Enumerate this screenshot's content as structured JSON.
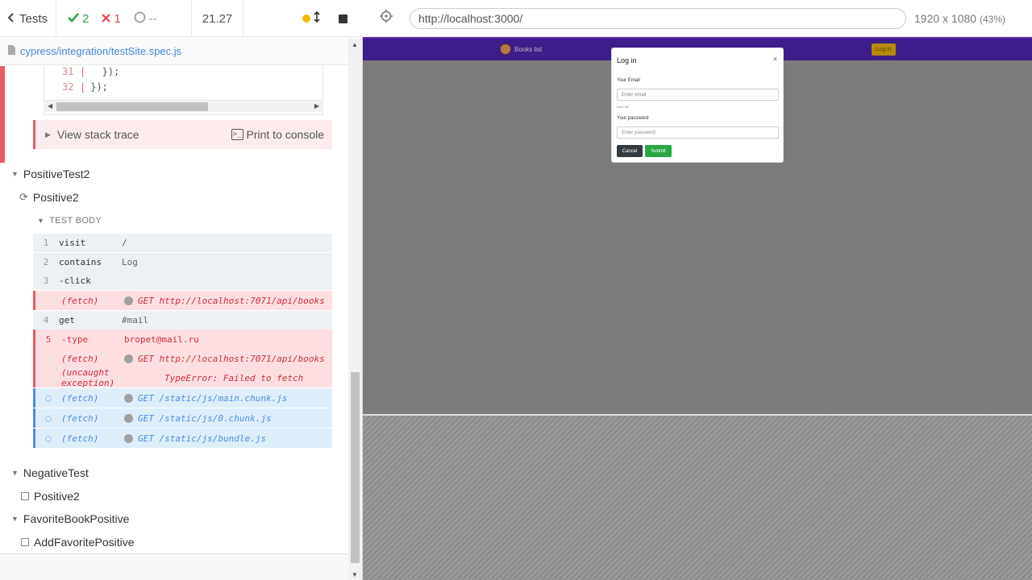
{
  "reporter": {
    "tests_label": "Tests",
    "passed": "2",
    "failed": "1",
    "pending": "--",
    "duration": "21.27",
    "spec_path": "cypress/integration/testSite.spec.js"
  },
  "code_lines": [
    {
      "num": "31",
      "text": "  });"
    },
    {
      "num": "32",
      "text": "});"
    }
  ],
  "error_footer": {
    "stack_trace": "View stack trace",
    "print": "Print to console",
    "console_icon": ">_"
  },
  "suites": {
    "positive_test2": "PositiveTest2",
    "positive2": "Positive2",
    "test_body": "TEST BODY",
    "negative_test": "NegativeTest",
    "negative_positive2": "Positive2",
    "favorite": "FavoriteBookPositive",
    "add_favorite": "AddFavoritePositive"
  },
  "commands": [
    {
      "num": "1",
      "name": "visit",
      "msg": "/"
    },
    {
      "num": "2",
      "name": "contains",
      "msg": "Log"
    },
    {
      "num": "3",
      "name": "-click",
      "msg": ""
    },
    {
      "num": "",
      "name": "(fetch)",
      "msg": "GET http://localhost:7071/api/books"
    },
    {
      "num": "4",
      "name": "get",
      "msg": "#mail"
    },
    {
      "num": "5",
      "name": "-type",
      "msg": "bropet@mail.ru"
    },
    {
      "num": "",
      "name": "(fetch)",
      "msg": "GET http://localhost:7071/api/books"
    },
    {
      "num": "",
      "name": "(uncaught exception)",
      "msg": "TypeError: Failed to fetch"
    },
    {
      "num": "",
      "name": "(fetch)",
      "msg": "GET /static/js/main.chunk.js"
    },
    {
      "num": "",
      "name": "(fetch)",
      "msg": "GET /static/js/0.chunk.js"
    },
    {
      "num": "",
      "name": "(fetch)",
      "msg": "GET /static/js/bundle.js"
    }
  ],
  "aut": {
    "url": "http://localhost:3000/",
    "viewport": "1920 x 1080",
    "scale": "(43%)",
    "nav_books": "Books list",
    "nav_login": "Log in",
    "modal_title": "Log in",
    "modal_close": "×",
    "email_label": "Your Email",
    "email_placeholder": "Enter email",
    "email_help": "have fun",
    "password_label": "Your password",
    "password_placeholder": "Enter password",
    "cancel": "Cancel",
    "submit": "Submit"
  },
  "colors": {
    "pass": "#2e9e4a",
    "fail": "#e0454c",
    "nav": "#3c1d8a",
    "login_btn": "#b58a05",
    "submit_btn": "#27a844"
  }
}
